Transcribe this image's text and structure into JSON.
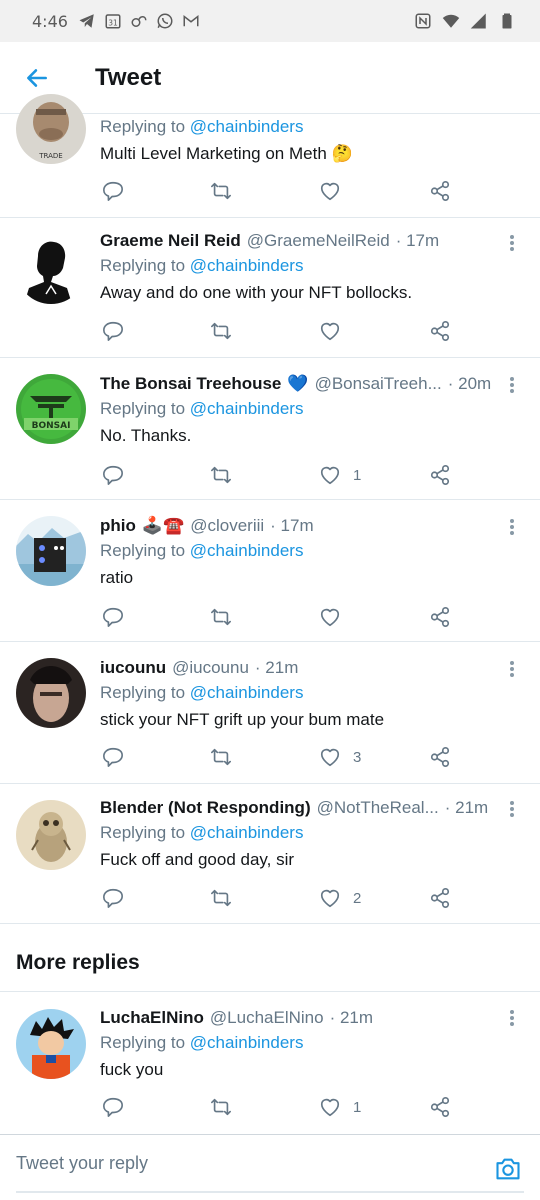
{
  "status_bar": {
    "time": "4:46",
    "left_icons": [
      "telegram-icon",
      "calendar-icon",
      "link-icon",
      "whatsapp-icon",
      "gmail-icon"
    ],
    "calendar_day": "31",
    "right_icons": [
      "nfc-icon",
      "wifi-icon",
      "signal-icon",
      "battery-icon"
    ]
  },
  "header": {
    "title": "Tweet",
    "back_icon": "back-arrow-icon"
  },
  "colors": {
    "accent": "#1b95e0",
    "verified": "#5aaaf2",
    "secondary_text": "#657786",
    "divider": "#e1e8ed"
  },
  "replies": [
    {
      "name": "",
      "handle": "",
      "time": "",
      "replying_prefix": "Replying to",
      "replying_to": "@chainbinders",
      "text": "Multi Level Marketing on Meth 🤔",
      "avatar": "avatar-photo-trade",
      "avatar_caption": "TRADE",
      "counts": {
        "replies": "",
        "retweets": "",
        "likes": ""
      }
    },
    {
      "name": "Graeme Neil Reid",
      "handle": "@GraemeNeilReid",
      "time": "· 17m",
      "replying_prefix": "Replying to",
      "replying_to": "@chainbinders",
      "text": "Away and do one with your NFT bollocks.",
      "avatar": "avatar-silhouette",
      "counts": {
        "replies": "",
        "retweets": "",
        "likes": ""
      }
    },
    {
      "name": "The Bonsai Treehouse",
      "name_emoji": "💙",
      "handle": "@BonsaiTreeh...",
      "time": "· 20m",
      "replying_prefix": "Replying to",
      "replying_to": "@chainbinders",
      "text": "No. Thanks.",
      "avatar": "avatar-bonsai-logo",
      "avatar_caption": "BONSAI",
      "counts": {
        "replies": "",
        "retweets": "",
        "likes": "1"
      }
    },
    {
      "name": "phio",
      "name_emoji": "🕹️☎️",
      "handle": "@cloveriii",
      "time": "· 17m",
      "replying_prefix": "Replying to",
      "replying_to": "@chainbinders",
      "text": "ratio",
      "avatar": "avatar-cartoon-speaker",
      "counts": {
        "replies": "",
        "retweets": "",
        "likes": ""
      }
    },
    {
      "name": "iucounu",
      "handle": "@iucounu",
      "time": "· 21m",
      "replying_prefix": "Replying to",
      "replying_to": "@chainbinders",
      "text": "stick your NFT grift up your bum mate",
      "avatar": "avatar-photo-face",
      "counts": {
        "replies": "",
        "retweets": "",
        "likes": "3"
      }
    },
    {
      "name": "Blender (Not Responding)",
      "handle": "@NotTheReal...",
      "time": "· 21m",
      "replying_prefix": "Replying to",
      "replying_to": "@chainbinders",
      "text": "Fuck off and good day, sir",
      "avatar": "avatar-sketch-owl",
      "counts": {
        "replies": "",
        "retweets": "",
        "likes": "2"
      }
    }
  ],
  "more_replies_label": "More replies",
  "more_replies": [
    {
      "name": "LuchaElNino",
      "handle": "@LuchaElNino",
      "time": "· 21m",
      "replying_prefix": "Replying to",
      "replying_to": "@chainbinders",
      "text": "fuck you",
      "avatar": "avatar-anime-goku",
      "counts": {
        "replies": "",
        "retweets": "",
        "likes": "1"
      }
    }
  ],
  "compose": {
    "placeholder": "Tweet your reply",
    "camera_icon": "camera-icon"
  }
}
